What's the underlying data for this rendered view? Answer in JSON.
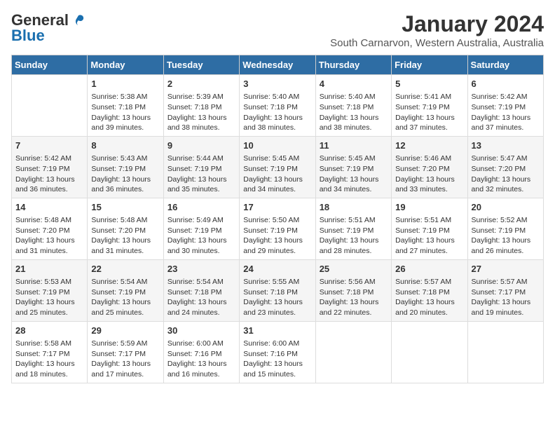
{
  "logo": {
    "general": "General",
    "blue": "Blue",
    "tagline": ""
  },
  "title": "January 2024",
  "subtitle": "South Carnarvon, Western Australia, Australia",
  "headers": [
    "Sunday",
    "Monday",
    "Tuesday",
    "Wednesday",
    "Thursday",
    "Friday",
    "Saturday"
  ],
  "weeks": [
    [
      {
        "day": "",
        "text": ""
      },
      {
        "day": "1",
        "text": "Sunrise: 5:38 AM\nSunset: 7:18 PM\nDaylight: 13 hours\nand 39 minutes."
      },
      {
        "day": "2",
        "text": "Sunrise: 5:39 AM\nSunset: 7:18 PM\nDaylight: 13 hours\nand 38 minutes."
      },
      {
        "day": "3",
        "text": "Sunrise: 5:40 AM\nSunset: 7:18 PM\nDaylight: 13 hours\nand 38 minutes."
      },
      {
        "day": "4",
        "text": "Sunrise: 5:40 AM\nSunset: 7:18 PM\nDaylight: 13 hours\nand 38 minutes."
      },
      {
        "day": "5",
        "text": "Sunrise: 5:41 AM\nSunset: 7:19 PM\nDaylight: 13 hours\nand 37 minutes."
      },
      {
        "day": "6",
        "text": "Sunrise: 5:42 AM\nSunset: 7:19 PM\nDaylight: 13 hours\nand 37 minutes."
      }
    ],
    [
      {
        "day": "7",
        "text": "Sunrise: 5:42 AM\nSunset: 7:19 PM\nDaylight: 13 hours\nand 36 minutes."
      },
      {
        "day": "8",
        "text": "Sunrise: 5:43 AM\nSunset: 7:19 PM\nDaylight: 13 hours\nand 36 minutes."
      },
      {
        "day": "9",
        "text": "Sunrise: 5:44 AM\nSunset: 7:19 PM\nDaylight: 13 hours\nand 35 minutes."
      },
      {
        "day": "10",
        "text": "Sunrise: 5:45 AM\nSunset: 7:19 PM\nDaylight: 13 hours\nand 34 minutes."
      },
      {
        "day": "11",
        "text": "Sunrise: 5:45 AM\nSunset: 7:19 PM\nDaylight: 13 hours\nand 34 minutes."
      },
      {
        "day": "12",
        "text": "Sunrise: 5:46 AM\nSunset: 7:20 PM\nDaylight: 13 hours\nand 33 minutes."
      },
      {
        "day": "13",
        "text": "Sunrise: 5:47 AM\nSunset: 7:20 PM\nDaylight: 13 hours\nand 32 minutes."
      }
    ],
    [
      {
        "day": "14",
        "text": "Sunrise: 5:48 AM\nSunset: 7:20 PM\nDaylight: 13 hours\nand 31 minutes."
      },
      {
        "day": "15",
        "text": "Sunrise: 5:48 AM\nSunset: 7:20 PM\nDaylight: 13 hours\nand 31 minutes."
      },
      {
        "day": "16",
        "text": "Sunrise: 5:49 AM\nSunset: 7:19 PM\nDaylight: 13 hours\nand 30 minutes."
      },
      {
        "day": "17",
        "text": "Sunrise: 5:50 AM\nSunset: 7:19 PM\nDaylight: 13 hours\nand 29 minutes."
      },
      {
        "day": "18",
        "text": "Sunrise: 5:51 AM\nSunset: 7:19 PM\nDaylight: 13 hours\nand 28 minutes."
      },
      {
        "day": "19",
        "text": "Sunrise: 5:51 AM\nSunset: 7:19 PM\nDaylight: 13 hours\nand 27 minutes."
      },
      {
        "day": "20",
        "text": "Sunrise: 5:52 AM\nSunset: 7:19 PM\nDaylight: 13 hours\nand 26 minutes."
      }
    ],
    [
      {
        "day": "21",
        "text": "Sunrise: 5:53 AM\nSunset: 7:19 PM\nDaylight: 13 hours\nand 25 minutes."
      },
      {
        "day": "22",
        "text": "Sunrise: 5:54 AM\nSunset: 7:19 PM\nDaylight: 13 hours\nand 25 minutes."
      },
      {
        "day": "23",
        "text": "Sunrise: 5:54 AM\nSunset: 7:18 PM\nDaylight: 13 hours\nand 24 minutes."
      },
      {
        "day": "24",
        "text": "Sunrise: 5:55 AM\nSunset: 7:18 PM\nDaylight: 13 hours\nand 23 minutes."
      },
      {
        "day": "25",
        "text": "Sunrise: 5:56 AM\nSunset: 7:18 PM\nDaylight: 13 hours\nand 22 minutes."
      },
      {
        "day": "26",
        "text": "Sunrise: 5:57 AM\nSunset: 7:18 PM\nDaylight: 13 hours\nand 20 minutes."
      },
      {
        "day": "27",
        "text": "Sunrise: 5:57 AM\nSunset: 7:17 PM\nDaylight: 13 hours\nand 19 minutes."
      }
    ],
    [
      {
        "day": "28",
        "text": "Sunrise: 5:58 AM\nSunset: 7:17 PM\nDaylight: 13 hours\nand 18 minutes."
      },
      {
        "day": "29",
        "text": "Sunrise: 5:59 AM\nSunset: 7:17 PM\nDaylight: 13 hours\nand 17 minutes."
      },
      {
        "day": "30",
        "text": "Sunrise: 6:00 AM\nSunset: 7:16 PM\nDaylight: 13 hours\nand 16 minutes."
      },
      {
        "day": "31",
        "text": "Sunrise: 6:00 AM\nSunset: 7:16 PM\nDaylight: 13 hours\nand 15 minutes."
      },
      {
        "day": "",
        "text": ""
      },
      {
        "day": "",
        "text": ""
      },
      {
        "day": "",
        "text": ""
      }
    ]
  ]
}
